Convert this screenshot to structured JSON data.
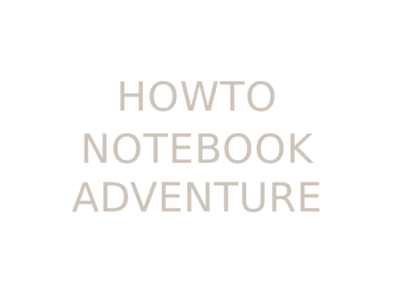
{
  "logo": {
    "line_1": "HOWTO",
    "line_2": "NOTEBOOK",
    "line_3": "ADVENTURE",
    "text_color": "#cdc3b8",
    "background_color": "#ffffff"
  }
}
